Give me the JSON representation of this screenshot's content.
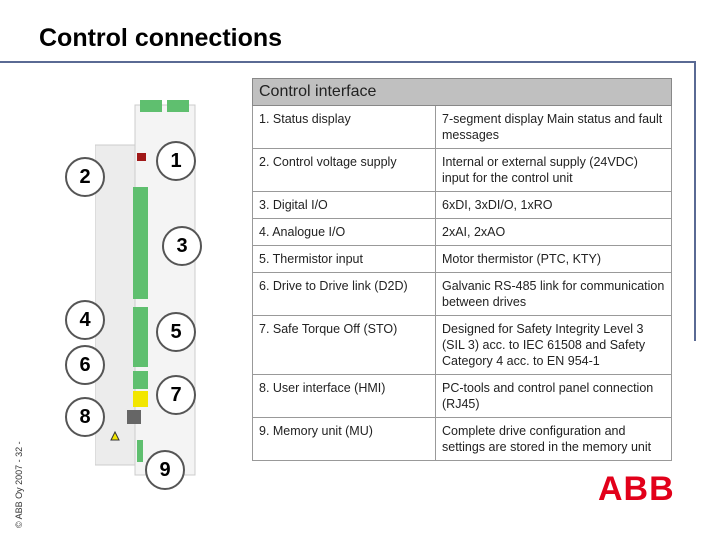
{
  "title": "Control connections",
  "copyright": "© ABB Oy 2007 - 32 -",
  "logo": "ABB",
  "table": {
    "header": "Control interface",
    "rows": [
      [
        "1. Status display",
        "7-segment display Main status and fault messages"
      ],
      [
        "2. Control voltage supply",
        "Internal or external supply (24VDC) input for the control unit"
      ],
      [
        "3. Digital I/O",
        "6xDI, 3xDI/O, 1xRO"
      ],
      [
        "4. Analogue I/O",
        "2xAI, 2xAO"
      ],
      [
        "5. Thermistor input",
        "Motor thermistor (PTC, KTY)"
      ],
      [
        "6. Drive to Drive link (D2D)",
        "Galvanic RS-485 link for communication between drives"
      ],
      [
        "7. Safe Torque Off (STO)",
        "Designed for Safety Integrity Level 3 (SIL 3) acc. to IEC 61508 and Safety Category 4 acc. to EN 954-1"
      ],
      [
        "8. User interface (HMI)",
        "PC-tools and control panel connection (RJ45)"
      ],
      [
        "9. Memory unit (MU)",
        "Complete drive configuration and settings are stored in the memory unit"
      ]
    ]
  },
  "callouts": [
    "1",
    "2",
    "3",
    "4",
    "5",
    "6",
    "7",
    "8",
    "9"
  ],
  "colors": {
    "frame": "#5a6a94",
    "header_bg": "#c0c0c0",
    "logo": "#e2001a",
    "terminal": "#5fbf6f",
    "sto": "#f2e600"
  }
}
